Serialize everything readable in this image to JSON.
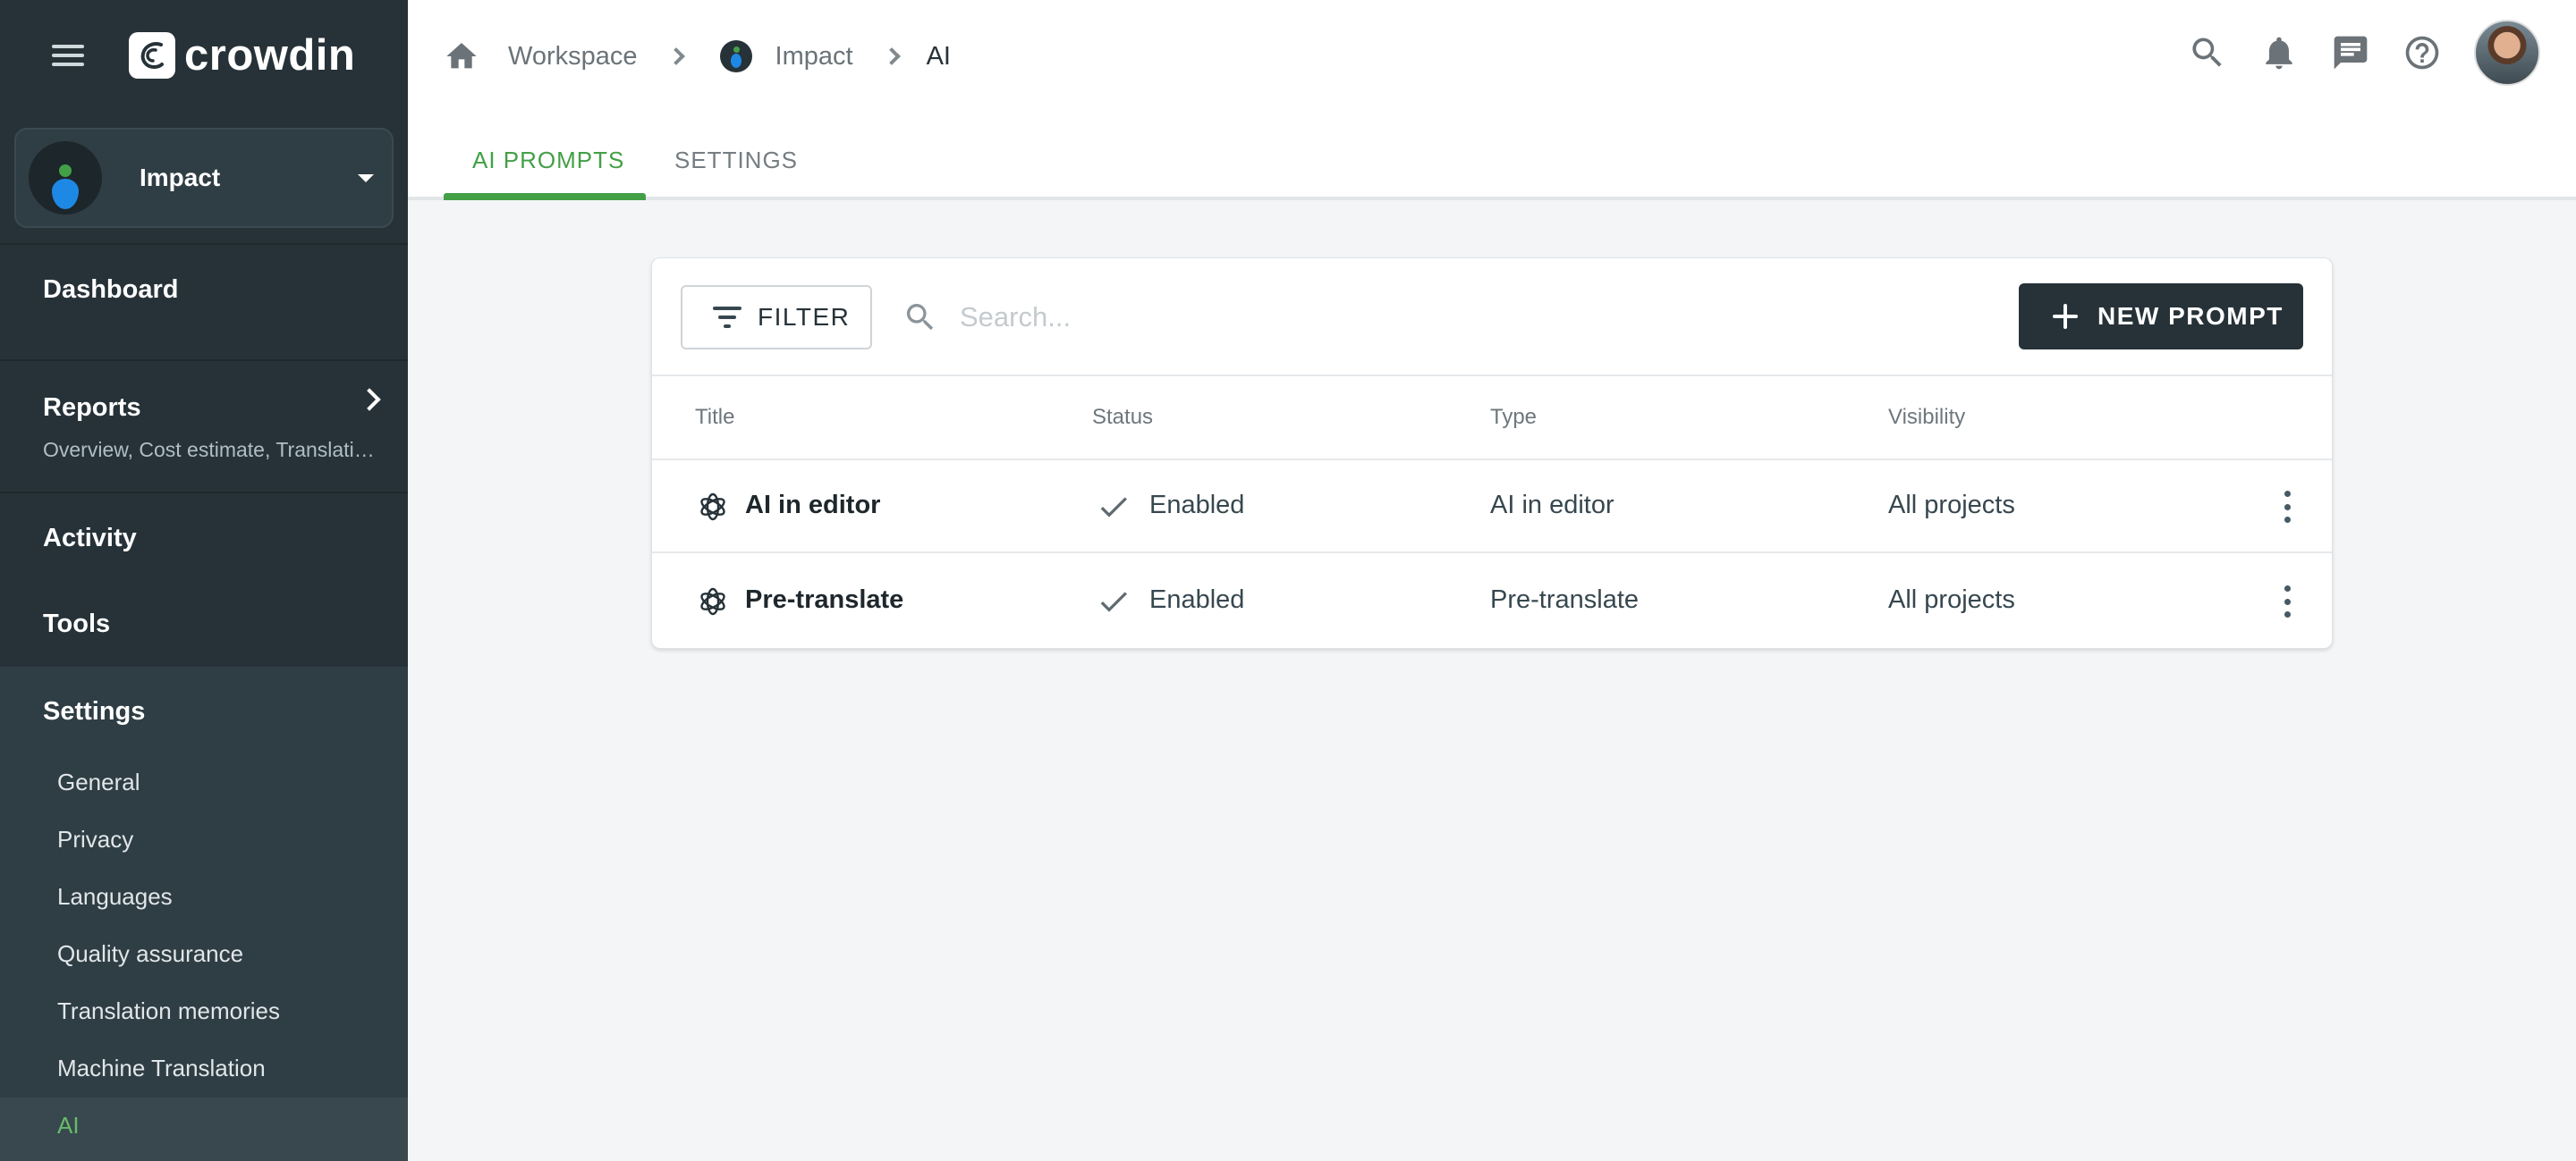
{
  "app": {
    "name": "crowdin"
  },
  "project": {
    "name": "Impact"
  },
  "sidebar": {
    "nav": {
      "dashboard": "Dashboard",
      "reports": "Reports",
      "reports_sub": "Overview, Cost estimate, Translation costs",
      "activity": "Activity",
      "tools": "Tools",
      "settings": "Settings"
    },
    "settings_items": [
      "General",
      "Privacy",
      "Languages",
      "Quality assurance",
      "Translation memories",
      "Machine Translation",
      "AI"
    ],
    "active_item": "AI"
  },
  "breadcrumb": {
    "workspace": "Workspace",
    "project": "Impact",
    "current": "AI"
  },
  "header_icons": [
    "search-icon",
    "bell-icon",
    "messages-icon",
    "help-icon"
  ],
  "tabs": [
    {
      "label": "AI PROMPTS",
      "active": true
    },
    {
      "label": "SETTINGS",
      "active": false
    }
  ],
  "toolbar": {
    "filter_label": "FILTER",
    "search_placeholder": "Search...",
    "new_label": "NEW PROMPT"
  },
  "table": {
    "columns": [
      "Title",
      "Status",
      "Type",
      "Visibility"
    ],
    "rows": [
      {
        "title": "AI in editor",
        "status": "Enabled",
        "type": "AI in editor",
        "visibility": "All projects"
      },
      {
        "title": "Pre-translate",
        "status": "Enabled",
        "type": "Pre-translate",
        "visibility": "All projects"
      }
    ]
  },
  "colors": {
    "sidebar": "#263238",
    "accent": "#43a047",
    "primary_button": "#263238"
  }
}
